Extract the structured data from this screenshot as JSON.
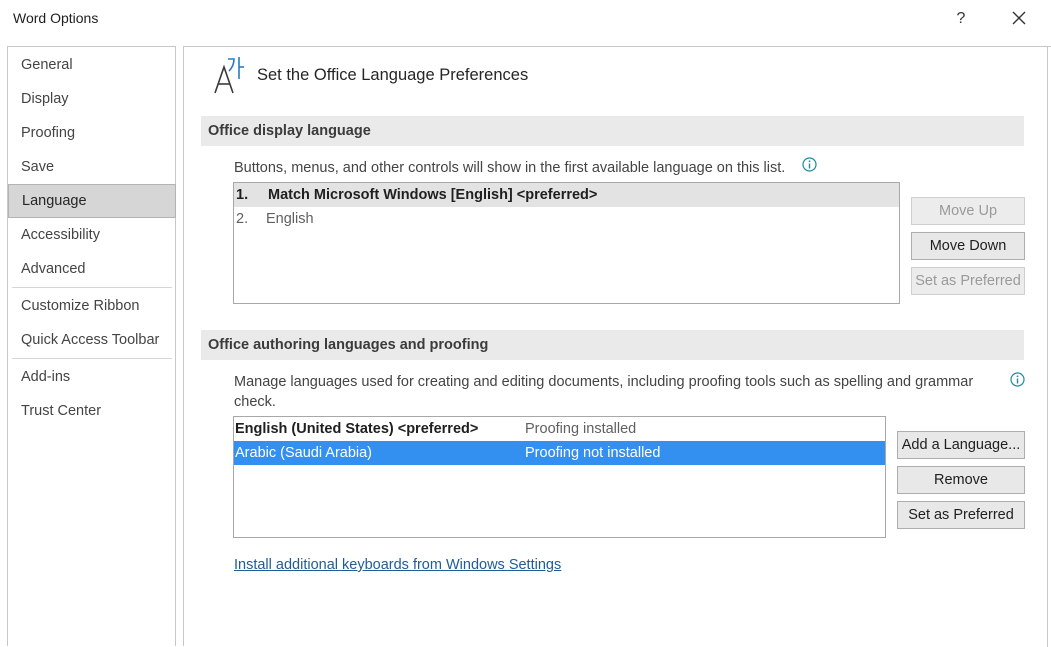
{
  "window": {
    "title": "Word Options",
    "help_label": "?"
  },
  "sidebar": {
    "items": [
      {
        "label": "General"
      },
      {
        "label": "Display"
      },
      {
        "label": "Proofing"
      },
      {
        "label": "Save"
      },
      {
        "label": "Language",
        "selected": true
      },
      {
        "label": "Accessibility"
      },
      {
        "label": "Advanced"
      },
      {
        "label": "Customize Ribbon"
      },
      {
        "label": "Quick Access Toolbar"
      },
      {
        "label": "Add-ins"
      },
      {
        "label": "Trust Center"
      }
    ]
  },
  "main": {
    "title": "Set the Office Language Preferences",
    "icon": "language-translate-icon",
    "display_language": {
      "header": "Office display language",
      "description": "Buttons, menus, and other controls will show in the first available language on this list.",
      "items": [
        {
          "number": "1.",
          "label": "Match Microsoft Windows [English] <preferred>",
          "selected": true
        },
        {
          "number": "2.",
          "label": "English",
          "selected": false
        }
      ],
      "buttons": {
        "move_up": "Move Up",
        "move_down": "Move Down",
        "set_preferred": "Set as Preferred"
      }
    },
    "authoring": {
      "header": "Office authoring languages and proofing",
      "description_line1": "Manage languages used for creating and editing documents, including proofing tools such as spelling and grammar",
      "description_line2": "check.",
      "items": [
        {
          "language": "English (United States) <preferred>",
          "status": "Proofing installed",
          "selected": false
        },
        {
          "language": "Arabic (Saudi Arabia)",
          "status": "Proofing not installed",
          "selected": true
        }
      ],
      "buttons": {
        "add_language": "Add a Language...",
        "remove": "Remove",
        "set_preferred": "Set as Preferred"
      }
    },
    "keyboard_link": "Install additional keyboards from Windows Settings"
  },
  "colors": {
    "selection_blue": "#3390f0",
    "section_header_bg": "#eaeaea",
    "link": "#1f5c99",
    "sidebar_selected": "#d6d6d6"
  }
}
